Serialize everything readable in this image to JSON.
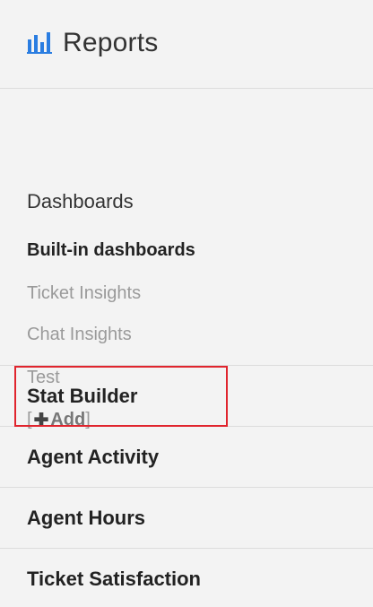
{
  "header": {
    "title": "Reports",
    "icon": "bar-chart-icon",
    "icon_color": "#2a7de1"
  },
  "dashboards": {
    "heading": "Dashboards",
    "group_label": "Built-in dashboards",
    "items": [
      "Ticket Insights",
      "Chat Insights",
      "Test"
    ],
    "add_open": "[",
    "add_label": "Add",
    "add_close": "]"
  },
  "nav": [
    {
      "label": "Stat Builder"
    },
    {
      "label": "Agent Activity"
    },
    {
      "label": "Agent Hours"
    },
    {
      "label": "Ticket Satisfaction"
    }
  ],
  "highlight_color": "#e0242d"
}
